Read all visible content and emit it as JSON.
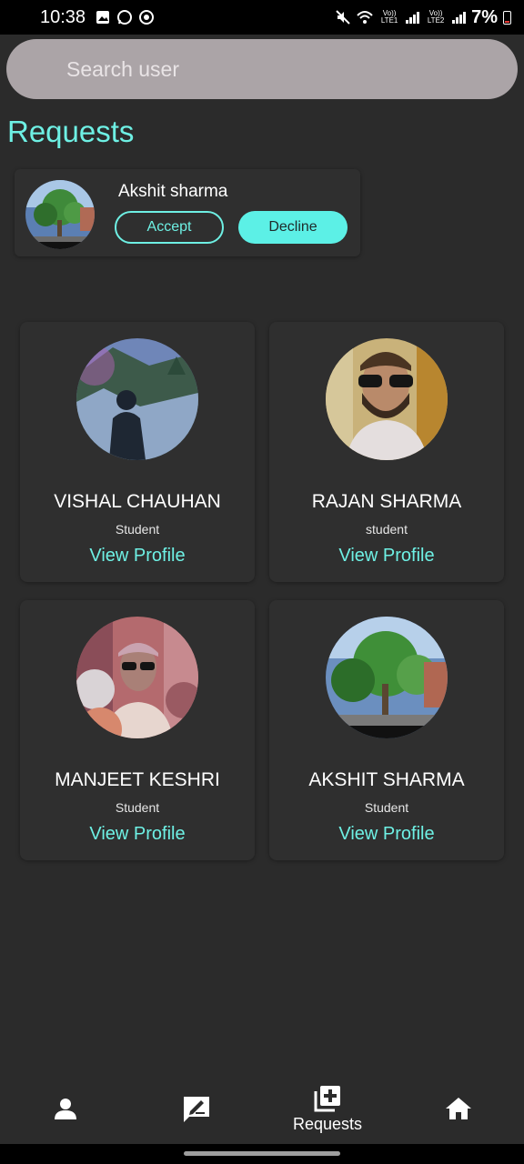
{
  "status_bar": {
    "time": "10:38",
    "left_icons": [
      "gallery-icon",
      "whatsapp-icon",
      "sync-icon"
    ],
    "right_icons": [
      "mute-icon",
      "wifi-icon",
      "signal-icon",
      "signal-icon",
      "battery-icon"
    ],
    "sim1_label": "Vo)) LTE1",
    "sim2_label": "Vo)) LTE2",
    "battery": "7%"
  },
  "search": {
    "placeholder": "Search user"
  },
  "requests": {
    "title": "Requests",
    "items": [
      {
        "name": "Akshit sharma",
        "accept_label": "Accept",
        "decline_label": "Decline"
      }
    ]
  },
  "users": [
    {
      "name": "VISHAL CHAUHAN",
      "role": "Student",
      "link": "View Profile"
    },
    {
      "name": "RAJAN SHARMA",
      "role": "student",
      "link": "View Profile"
    },
    {
      "name": "MANJEET KESHRI",
      "role": "Student",
      "link": "View Profile"
    },
    {
      "name": "AKSHIT SHARMA",
      "role": "Student",
      "link": "View Profile"
    }
  ],
  "bottom_nav": {
    "items": [
      {
        "icon": "person-icon",
        "label": ""
      },
      {
        "icon": "edit-icon",
        "label": ""
      },
      {
        "icon": "add-box-icon",
        "label": "Requests"
      },
      {
        "icon": "home-icon",
        "label": ""
      }
    ]
  },
  "colors": {
    "accent": "#6ef0e4",
    "background": "#2b2b2b",
    "card": "#2f2f2f",
    "search_bg": "#aba4a7"
  }
}
